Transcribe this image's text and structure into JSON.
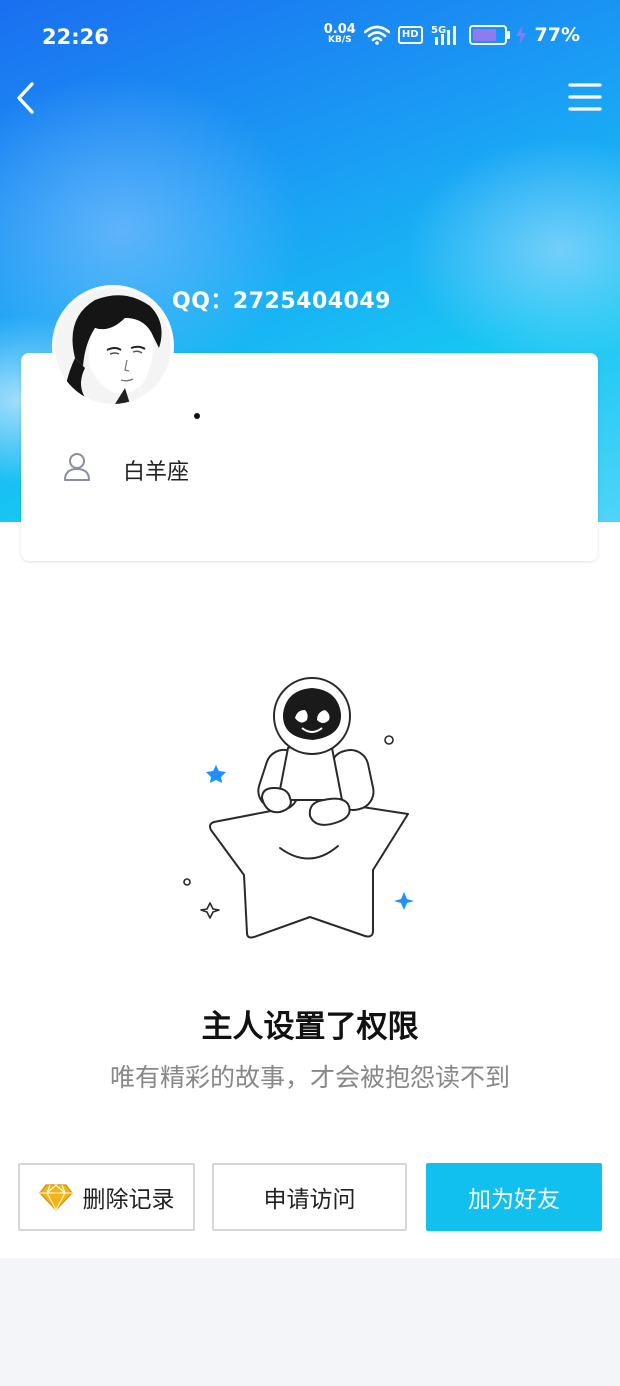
{
  "status_bar": {
    "time": "22:26",
    "net_speed_value": "0.04",
    "net_speed_unit": "KB/S",
    "hd_badge": "HD",
    "network_type": "5G",
    "battery_percent": "77%",
    "battery_level": 0.77
  },
  "nav": {
    "back_icon": "chevron-left-icon",
    "menu_icon": "hamburger-menu-icon"
  },
  "profile": {
    "qq_label": "QQ：2725404049",
    "nickname": "·",
    "signature": "白羊座"
  },
  "empty_state": {
    "title": "主人设置了权限",
    "subtitle": "唯有精彩的故事，才会被抱怨读不到"
  },
  "actions": {
    "delete_label": "删除记录",
    "request_label": "申请访问",
    "add_friend_label": "加为好友"
  },
  "colors": {
    "accent": "#12c0f0",
    "header_blue": "#1aa0f5",
    "star_blue": "#1e90ff",
    "diamond": "#f5b31b"
  }
}
